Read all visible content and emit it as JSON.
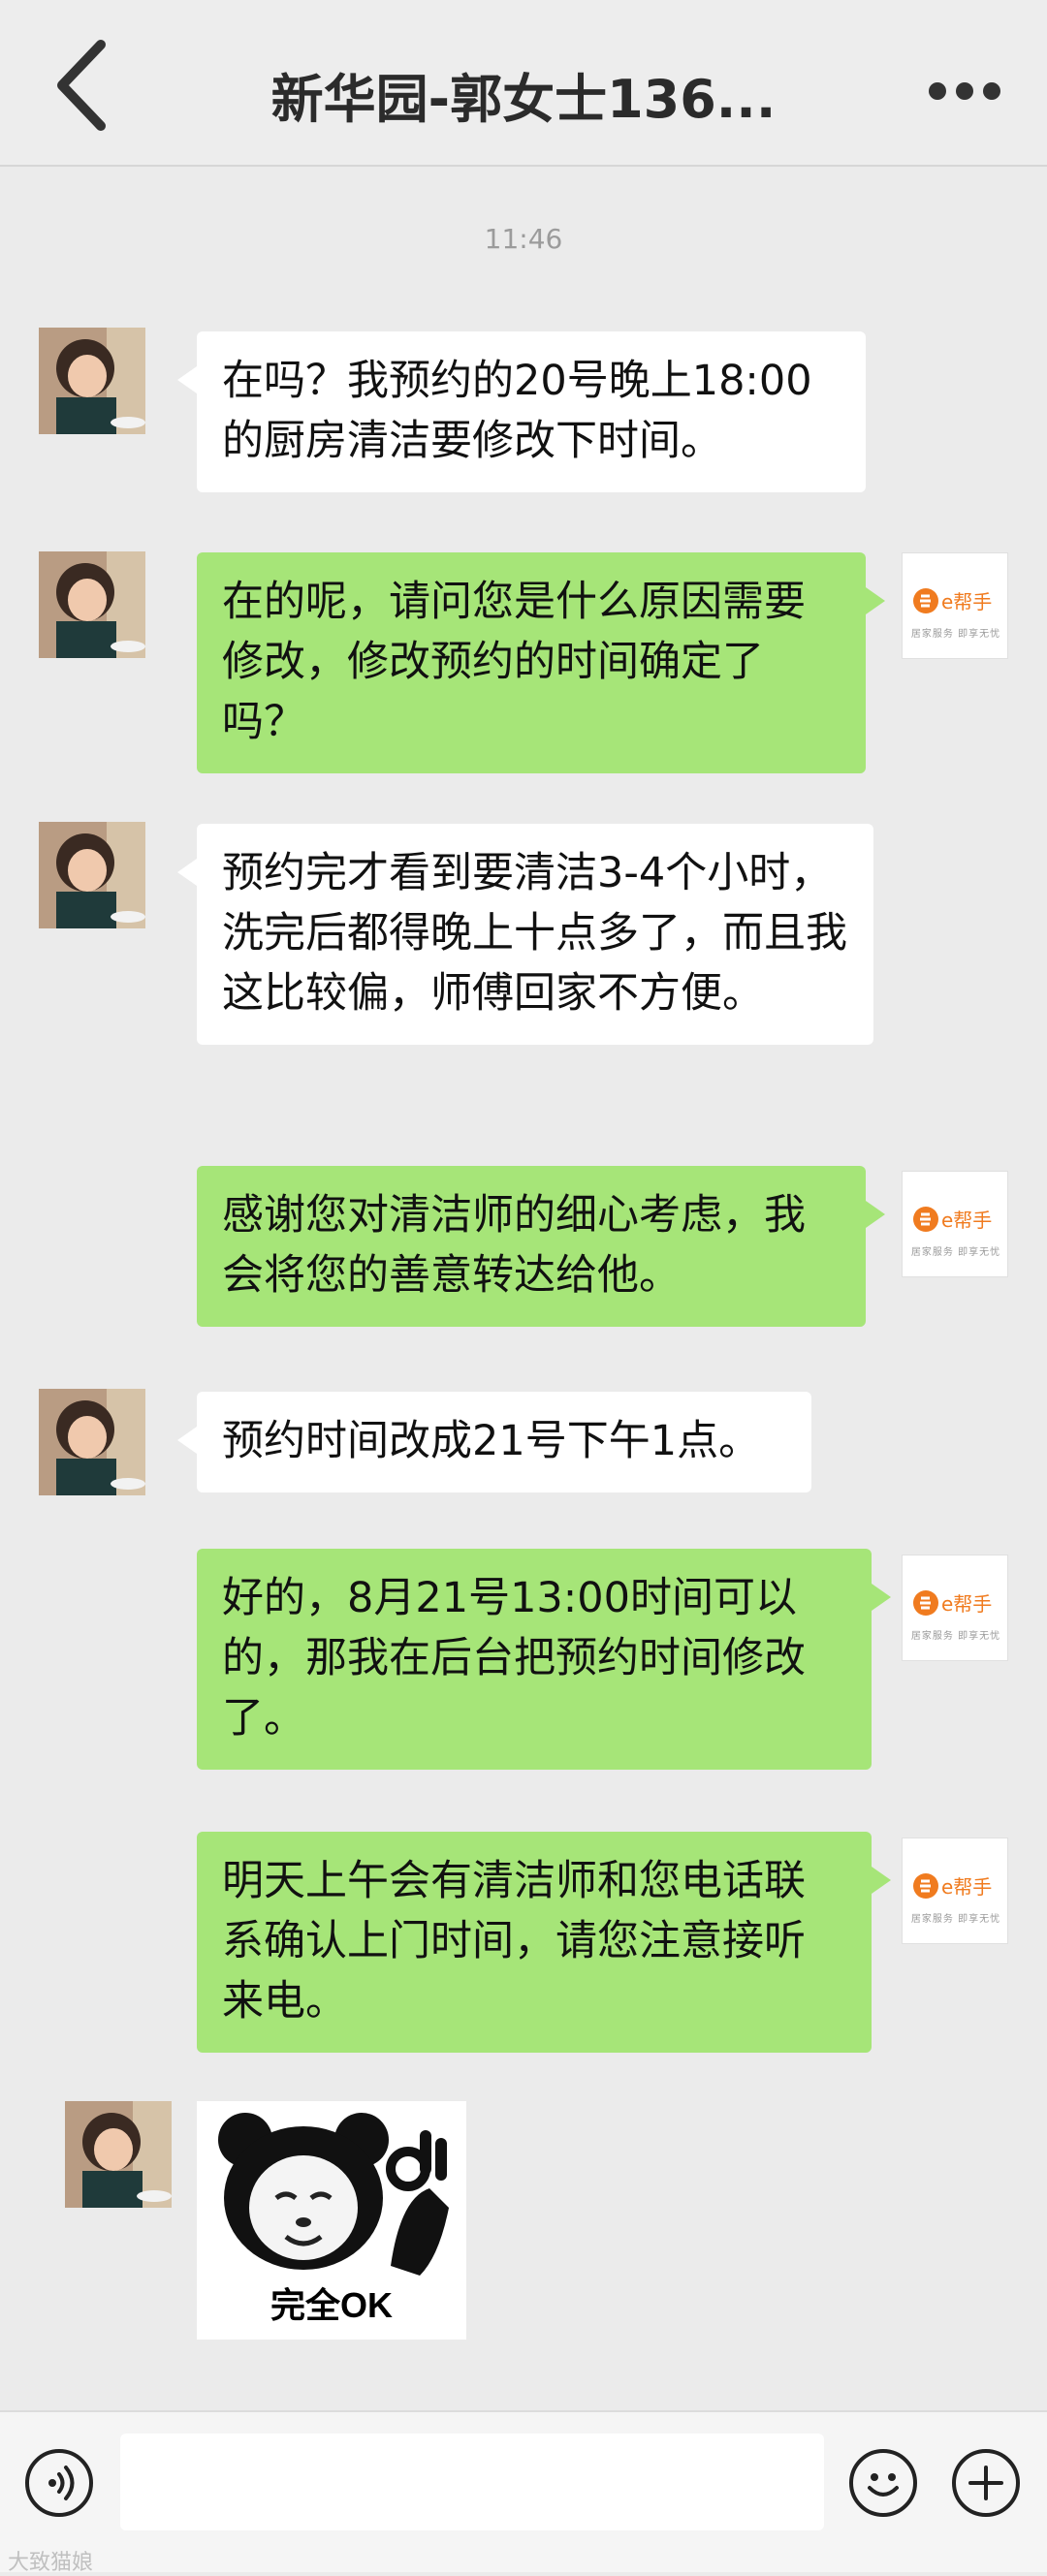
{
  "header": {
    "title": "新华园-郭女士136..."
  },
  "timestamp": "11:46",
  "messages": [
    {
      "side": "left",
      "text": "在吗？我预约的20号晚上18:00的厨房清洁要修改下时间。"
    },
    {
      "side": "right",
      "text": "在的呢，请问您是什么原因需要修改，修改预约的时间确定了吗？"
    },
    {
      "side": "left",
      "text": "预约完才看到要清洁3-4个小时，洗完后都得晚上十点多了，而且我这比较偏，师傅回家不方便。"
    },
    {
      "side": "right",
      "text": "感谢您对清洁师的细心考虑，我会将您的善意转达给他。"
    },
    {
      "side": "left",
      "text": "预约时间改成21号下午1点。"
    },
    {
      "side": "right",
      "text": "好的，8月21号13:00时间可以的，那我在后台把预约时间修改了。"
    },
    {
      "side": "right",
      "text": "明天上午会有清洁师和您电话联系确认上门时间，请您注意接听来电。"
    }
  ],
  "brand": {
    "name": "e帮手",
    "tagline": "居家服务 即享无忧",
    "color": "#f07b1f"
  },
  "sticker": {
    "caption": "完全OK"
  },
  "watermark": "大致猫娘",
  "colors": {
    "bubble_right": "#a6e578",
    "bubble_left": "#ffffff",
    "background": "#ebebeb"
  },
  "icons": {
    "back": "chevron-left-icon",
    "more": "more-dots-icon",
    "voice": "voice-icon",
    "emoji": "emoji-icon",
    "add": "plus-icon"
  }
}
